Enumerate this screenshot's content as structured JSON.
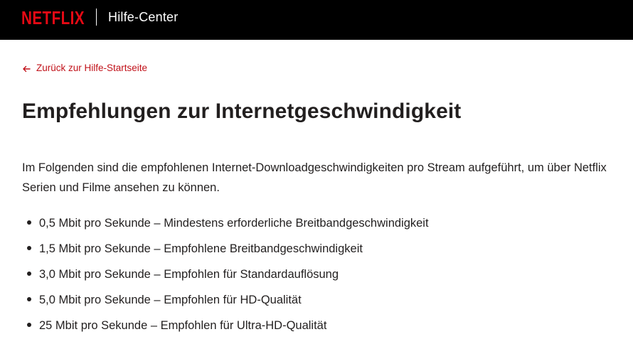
{
  "header": {
    "logo_text": "NETFLIX",
    "title": "Hilfe-Center"
  },
  "back_link": {
    "label": "Zurück zur Hilfe-Startseite",
    "icon": "arrow-left-icon"
  },
  "article": {
    "title": "Empfehlungen zur Internetgeschwindigkeit",
    "intro": "Im Folgenden sind die empfohlenen Internet-Downloadgeschwindigkeiten pro Stream aufgeführt, um über Netflix Serien und Filme ansehen zu können.",
    "speeds": [
      "0,5 Mbit pro Sekunde – Mindestens erforderliche Breitbandgeschwindigkeit",
      "1,5 Mbit pro Sekunde – Empfohlene Breitbandgeschwindigkeit",
      "3,0 Mbit pro Sekunde – Empfohlen für Standardauflösung",
      "5,0 Mbit pro Sekunde – Empfohlen für HD-Qualität",
      "25 Mbit pro Sekunde – Empfohlen für Ultra-HD-Qualität"
    ]
  },
  "colors": {
    "brand": "#e50914",
    "link": "#c11119",
    "header_bg": "#000000",
    "text": "#221f1f"
  }
}
